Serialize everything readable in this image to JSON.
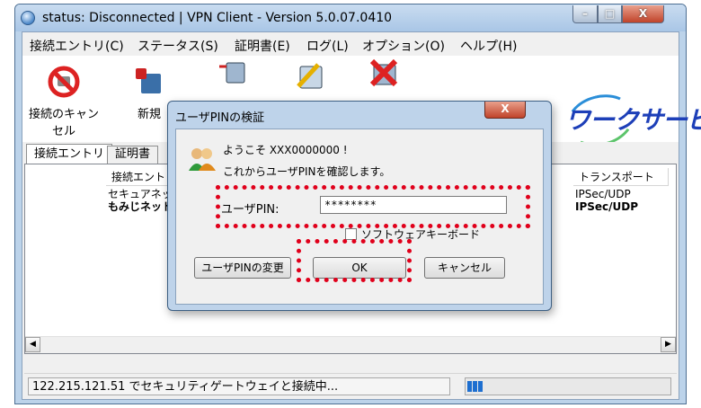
{
  "window": {
    "title": "status: Disconnected | VPN Client - Version 5.0.07.0410",
    "minimize": "–",
    "maximize": "□",
    "close": "X"
  },
  "menu": [
    "接続エントリ(C)",
    "ステータス(S)",
    "証明書(E)",
    "ログ(L)",
    "オプション(O)",
    "ヘルプ(H)"
  ],
  "toolbar": {
    "cancel_label": "接続のキャンセル",
    "new_label": "新規"
  },
  "brand": {
    "text": "ワークサービス"
  },
  "tabs": [
    "接続エントリ",
    "証明書"
  ],
  "list": {
    "headers": {
      "entry": "接続エントリ",
      "transport": "トランスポート"
    },
    "rows": [
      {
        "entry": "セキュアネット",
        "transport": "IPSec/UDP"
      },
      {
        "entry": "もみじネット",
        "transport": "IPSec/UDP"
      }
    ]
  },
  "status": {
    "text": "122.215.121.51 でセキュリティゲートウェイと接続中...",
    "progress": 0.08
  },
  "dialog": {
    "title": "ユーザPINの検証",
    "close": "X",
    "welcome": "ようこそ XXX0000000 !",
    "message": "これからユーザPINを確認します。",
    "pin_label": "ユーザPIN:",
    "pin_value": "********",
    "keyboard_label": "ソフトウェアキーボード",
    "change_pin_button": "ユーザPINの変更",
    "ok_button": "OK",
    "cancel_button": "キャンセル"
  },
  "colors": {
    "highlight": "#e0001b",
    "accent": "#1e6fd0"
  }
}
